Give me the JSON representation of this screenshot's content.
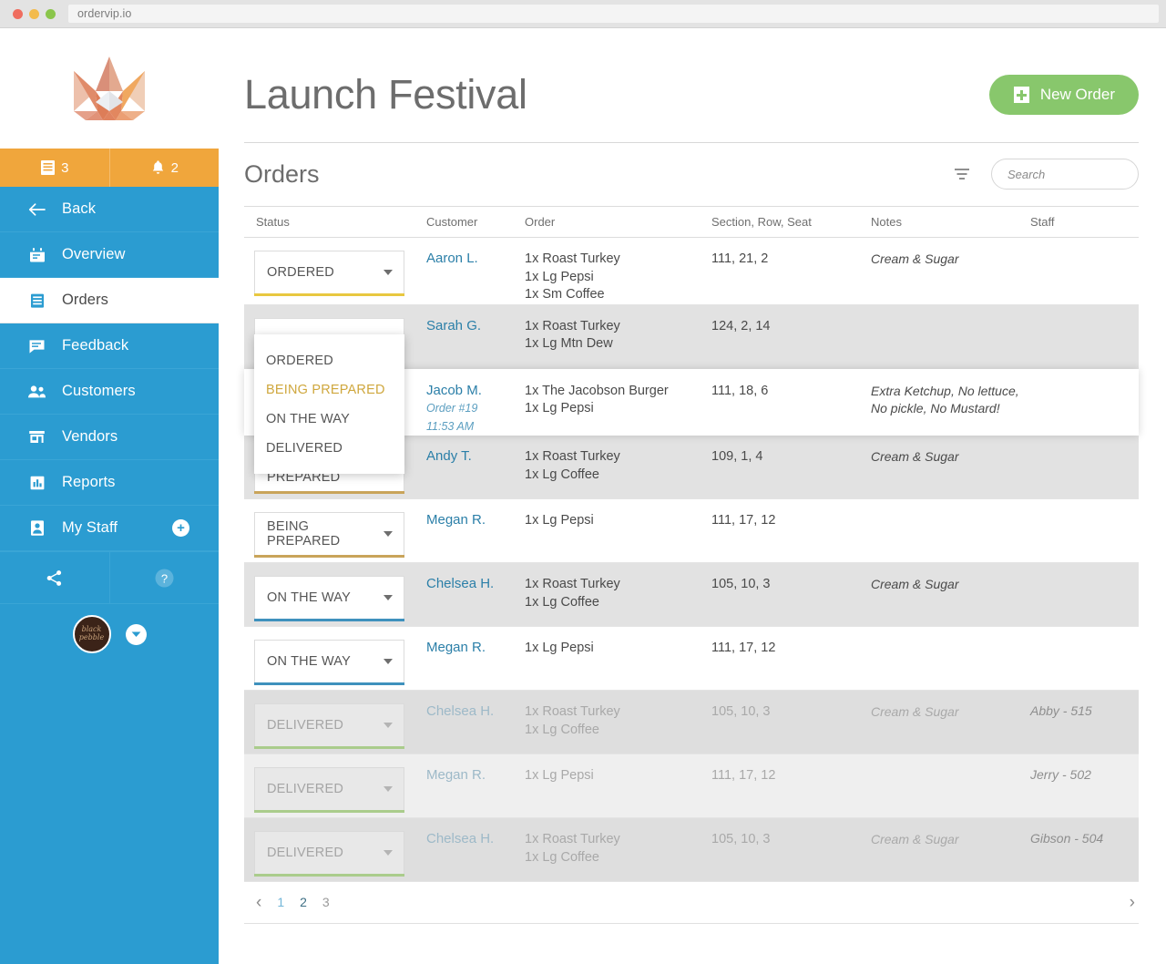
{
  "browser": {
    "url": "ordervip.io"
  },
  "sidebar": {
    "logo_name": "crown-logo",
    "counters": [
      {
        "icon": "receipt-icon",
        "value": "3"
      },
      {
        "icon": "bell-icon",
        "value": "2"
      }
    ],
    "back_label": "Back",
    "items": [
      {
        "label": "Overview",
        "icon": "calendar-icon",
        "active": false
      },
      {
        "label": "Orders",
        "icon": "list-icon",
        "active": true
      },
      {
        "label": "Feedback",
        "icon": "chat-icon",
        "active": false
      },
      {
        "label": "Customers",
        "icon": "people-icon",
        "active": false
      },
      {
        "label": "Vendors",
        "icon": "store-icon",
        "active": false
      },
      {
        "label": "Reports",
        "icon": "bar-chart-icon",
        "active": false
      },
      {
        "label": "My Staff",
        "icon": "badge-icon",
        "active": false,
        "action": "add-staff-button"
      }
    ],
    "footer": {
      "share_icon": "share-icon",
      "help_icon": "help-icon"
    },
    "user": {
      "avatar_text": "black pebble",
      "caret_icon": "chevron-down-icon"
    }
  },
  "header": {
    "title": "Launch Festival",
    "new_order_label": "New Order"
  },
  "section": {
    "title": "Orders",
    "filter_icon": "filter-icon",
    "search_placeholder": "Search",
    "search_value": "",
    "search_icon": "search-icon"
  },
  "table": {
    "columns": [
      "Status",
      "Customer",
      "Order",
      "Section, Row, Seat",
      "Notes",
      "Staff"
    ],
    "rows": [
      {
        "status": "ORDERED",
        "accent": "#e8c840",
        "muted": false,
        "customer": "Aaron L.",
        "order_id": "",
        "order_time": "",
        "items": [
          "1x Roast Turkey",
          "1x Lg Pepsi",
          "1x Sm Coffee"
        ],
        "seat": "111, 21, 2",
        "notes": "Cream & Sugar",
        "staff": "",
        "shade": "white"
      },
      {
        "status": "ORDERED",
        "accent": "#e8c840",
        "muted": false,
        "customer": "Sarah G.",
        "order_id": "",
        "order_time": "",
        "items": [
          "1x Roast Turkey",
          "1x Lg Mtn Dew"
        ],
        "seat": "124, 2, 14",
        "notes": "",
        "staff": "",
        "shade": "alt"
      },
      {
        "status": "BEING PREPARED",
        "accent": "#c9a45a",
        "muted": false,
        "customer": "Jacob M.",
        "order_id": "Order #19",
        "order_time": "11:53 AM",
        "items": [
          "1x The Jacobson Burger",
          "1x Lg Pepsi"
        ],
        "seat": "111, 18, 6",
        "notes": "Extra Ketchup, No lettuce, No pickle, No Mustard!",
        "staff": "",
        "shade": "highlight"
      },
      {
        "status": "BEING PREPARED",
        "accent": "#c9a45a",
        "muted": false,
        "customer": "Andy T.",
        "order_id": "",
        "order_time": "",
        "items": [
          "1x Roast Turkey",
          "1x Lg Coffee"
        ],
        "seat": "109, 1, 4",
        "notes": "Cream & Sugar",
        "staff": "",
        "shade": "alt"
      },
      {
        "status": "BEING PREPARED",
        "accent": "#c9a45a",
        "muted": false,
        "customer": "Megan R.",
        "order_id": "",
        "order_time": "",
        "items": [
          "1x Lg Pepsi"
        ],
        "seat": "111, 17, 12",
        "notes": "",
        "staff": "",
        "shade": "white"
      },
      {
        "status": "ON THE WAY",
        "accent": "#3f91bd",
        "muted": false,
        "customer": "Chelsea H.",
        "order_id": "",
        "order_time": "",
        "items": [
          "1x Roast Turkey",
          "1x Lg Coffee"
        ],
        "seat": "105, 10, 3",
        "notes": "Cream & Sugar",
        "staff": "",
        "shade": "alt"
      },
      {
        "status": "ON THE WAY",
        "accent": "#3f91bd",
        "muted": false,
        "customer": "Megan R.",
        "order_id": "",
        "order_time": "",
        "items": [
          "1x Lg Pepsi"
        ],
        "seat": "111, 17, 12",
        "notes": "",
        "staff": "",
        "shade": "white"
      },
      {
        "status": "DELIVERED",
        "accent": "#aacc8c",
        "muted": true,
        "customer": "Chelsea H.",
        "order_id": "",
        "order_time": "",
        "items": [
          "1x Roast Turkey",
          "1x Lg Coffee"
        ],
        "seat": "105, 10, 3",
        "notes": "Cream & Sugar",
        "staff": "Abby - 515",
        "shade": "ghost"
      },
      {
        "status": "DELIVERED",
        "accent": "#aacc8c",
        "muted": true,
        "customer": "Megan R.",
        "order_id": "",
        "order_time": "",
        "items": [
          "1x Lg Pepsi"
        ],
        "seat": "111, 17, 12",
        "notes": "",
        "staff": "Jerry - 502",
        "shade": "ghost-light"
      },
      {
        "status": "DELIVERED",
        "accent": "#aacc8c",
        "muted": true,
        "customer": "Chelsea H.",
        "order_id": "",
        "order_time": "",
        "items": [
          "1x Roast Turkey",
          "1x Lg Coffee"
        ],
        "seat": "105, 10, 3",
        "notes": "Cream & Sugar",
        "staff": "Gibson - 504",
        "shade": "ghost"
      }
    ]
  },
  "status_dropdown": {
    "open": true,
    "options": [
      "ORDERED",
      "BEING PREPARED",
      "ON THE WAY",
      "DELIVERED"
    ],
    "selected": "BEING PREPARED"
  },
  "pagination": {
    "prev_icon": "chevron-left-icon",
    "next_icon": "chevron-right-icon",
    "pages": [
      "1",
      "2",
      "3"
    ]
  },
  "colors": {
    "sidebar": "#2b9cd1",
    "counter_bar": "#f0a63c",
    "accent_green": "#88c76c",
    "ordered": "#e8c840",
    "being_prepared": "#c9a45a",
    "on_the_way": "#3f91bd",
    "delivered": "#aacc8c"
  }
}
